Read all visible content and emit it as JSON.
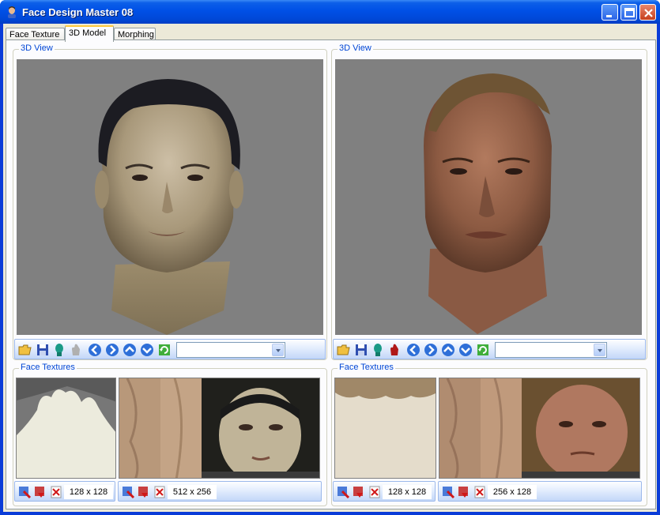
{
  "window": {
    "title": "Face Design Master 08"
  },
  "tabs": [
    {
      "label": "Face Texture"
    },
    {
      "label": "3D Model"
    },
    {
      "label": "Morphing"
    }
  ],
  "left": {
    "view_title": "3D View",
    "combo_value": "",
    "textures_title": "Face Textures",
    "tex1_size": "128 x 128",
    "tex2_size": "512 x 256"
  },
  "right": {
    "view_title": "3D View",
    "combo_value": "",
    "textures_title": "Face Textures",
    "tex1_size": "128 x 128",
    "tex2_size": "256 x 128"
  },
  "colors": {
    "accent": "#0046d5",
    "titlebar": "#0050e6",
    "view_bg": "#808080"
  }
}
